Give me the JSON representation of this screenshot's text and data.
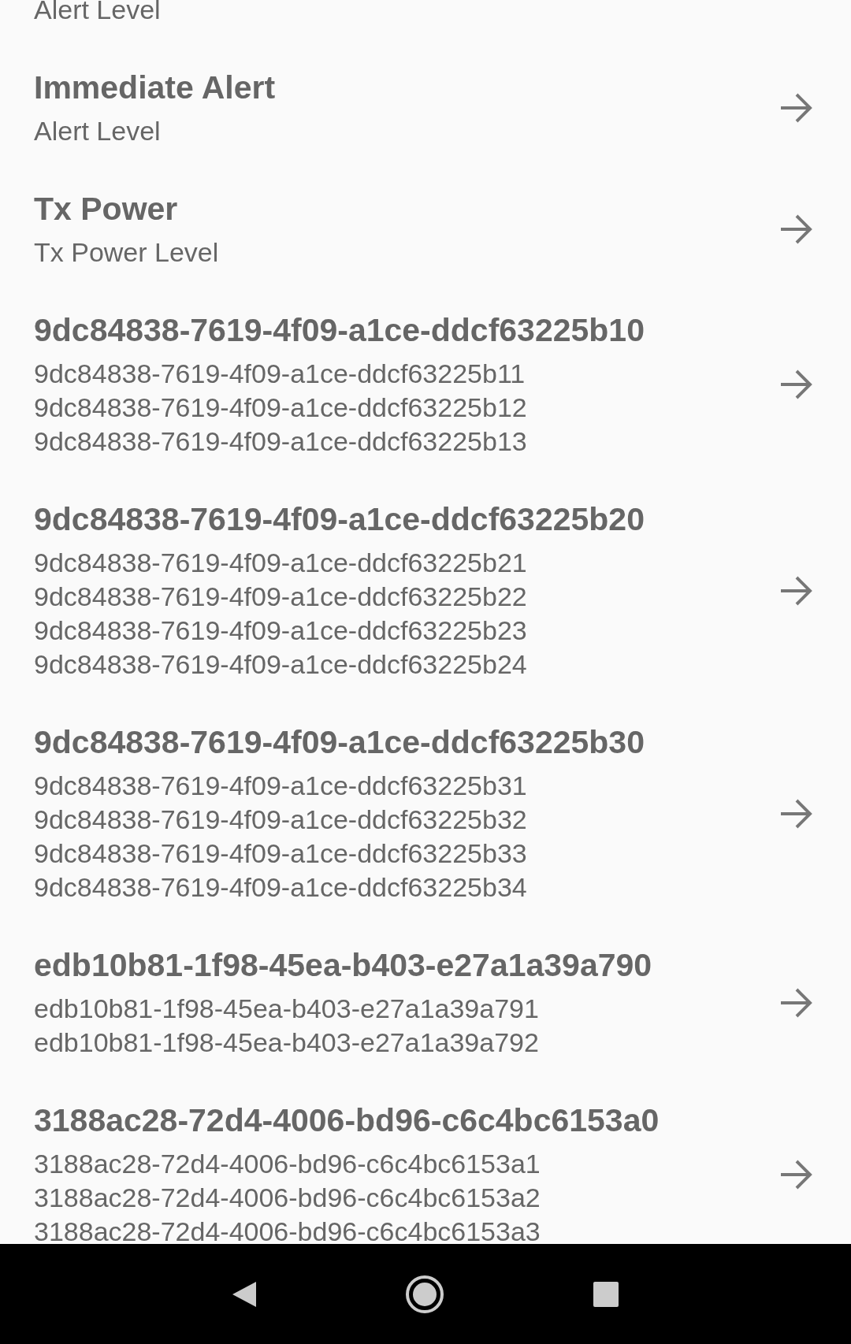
{
  "services": [
    {
      "subtitles": [
        "Alert Level"
      ]
    },
    {
      "title": "Immediate Alert",
      "subtitles": [
        "Alert Level"
      ]
    },
    {
      "title": "Tx Power",
      "subtitles": [
        "Tx Power Level"
      ]
    },
    {
      "title": "9dc84838-7619-4f09-a1ce-ddcf63225b10",
      "subtitles": [
        "9dc84838-7619-4f09-a1ce-ddcf63225b11",
        "9dc84838-7619-4f09-a1ce-ddcf63225b12",
        "9dc84838-7619-4f09-a1ce-ddcf63225b13"
      ]
    },
    {
      "title": "9dc84838-7619-4f09-a1ce-ddcf63225b20",
      "subtitles": [
        "9dc84838-7619-4f09-a1ce-ddcf63225b21",
        "9dc84838-7619-4f09-a1ce-ddcf63225b22",
        "9dc84838-7619-4f09-a1ce-ddcf63225b23",
        "9dc84838-7619-4f09-a1ce-ddcf63225b24"
      ]
    },
    {
      "title": "9dc84838-7619-4f09-a1ce-ddcf63225b30",
      "subtitles": [
        "9dc84838-7619-4f09-a1ce-ddcf63225b31",
        "9dc84838-7619-4f09-a1ce-ddcf63225b32",
        "9dc84838-7619-4f09-a1ce-ddcf63225b33",
        "9dc84838-7619-4f09-a1ce-ddcf63225b34"
      ]
    },
    {
      "title": "edb10b81-1f98-45ea-b403-e27a1a39a790",
      "subtitles": [
        "edb10b81-1f98-45ea-b403-e27a1a39a791",
        "edb10b81-1f98-45ea-b403-e27a1a39a792"
      ]
    },
    {
      "title": "3188ac28-72d4-4006-bd96-c6c4bc6153a0",
      "subtitles": [
        "3188ac28-72d4-4006-bd96-c6c4bc6153a1",
        "3188ac28-72d4-4006-bd96-c6c4bc6153a2",
        "3188ac28-72d4-4006-bd96-c6c4bc6153a3"
      ]
    }
  ]
}
